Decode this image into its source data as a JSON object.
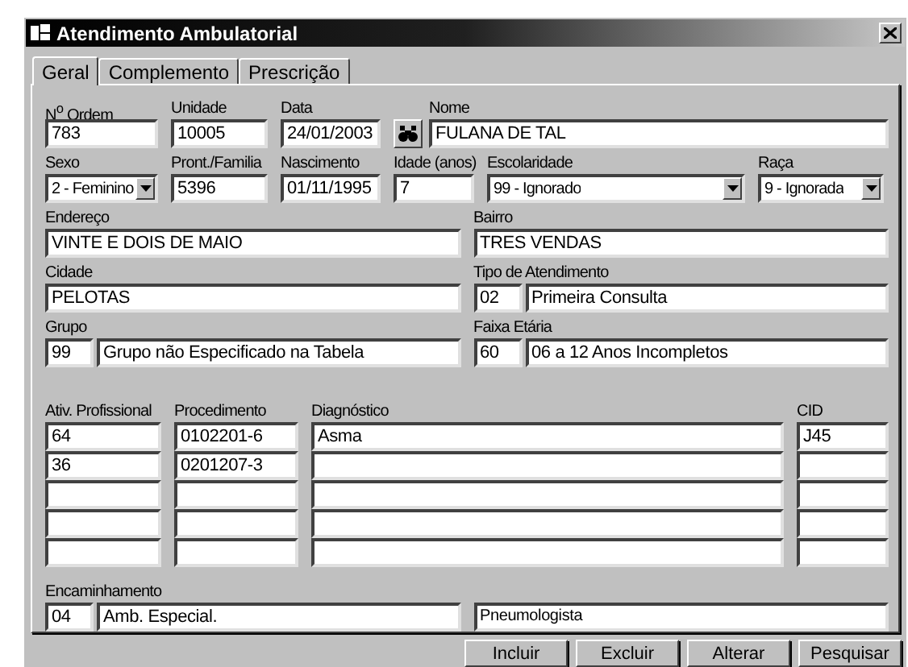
{
  "window": {
    "title": "Atendimento Ambulatorial"
  },
  "tabs": [
    {
      "label": "Geral",
      "selected": true
    },
    {
      "label": "Complemento",
      "selected": false
    },
    {
      "label": "Prescrição",
      "selected": false
    }
  ],
  "rows": [
    [
      {
        "kind": "text",
        "label": "N$^{o}$ Ordem",
        "value": "783"
      },
      {
        "kind": "text",
        "label": "Unidade",
        "value": "10005"
      },
      {
        "kind": "text",
        "label": "Data",
        "value": "24/01/2003"
      },
      {
        "kind": "search",
        "label": "Nome",
        "value": "FULANA DE TAL"
      }
    ],
    [
      {
        "kind": "select",
        "label": "Sexo",
        "value": "2 - Feminino"
      },
      {
        "kind": "text",
        "label": "Pront./Familia",
        "value": "5396"
      },
      {
        "kind": "text",
        "label": "Nascimento",
        "value": "01/11/1995"
      },
      {
        "kind": "text",
        "label": "Idade (anos)",
        "value": "7"
      },
      {
        "kind": "select",
        "label": "Escolaridade",
        "value": "99 - Ignorado"
      },
      {
        "kind": "select",
        "label": "Raça",
        "value": "9 - Ignorada"
      }
    ],
    [
      {
        "kind": "text",
        "label": "Endereço",
        "value": "VINTE E DOIS DE MAIO"
      },
      {
        "kind": "text",
        "label": "Bairro",
        "value": "TRES VENDAS"
      }
    ],
    [
      {
        "kind": "text",
        "label": "Cidade",
        "value": "PELOTAS"
      },
      {
        "kind": "coded",
        "label": "Tipo de Atendimento",
        "code": "02",
        "value": "Primeira Consulta"
      }
    ],
    [
      {
        "kind": "coded",
        "label": "Grupo",
        "code": "99",
        "value": "Grupo não Especificado na Tabela"
      },
      {
        "kind": "coded",
        "label": "Faixa Etária",
        "code": "60",
        "value": "06 a 12 Anos Incompletos"
      }
    ]
  ],
  "procedures": {
    "columns": [
      "Ativ. Profissional",
      "Procedimento",
      "Diagnóstico",
      "CID"
    ],
    "rows": [
      {
        "ativ": "64",
        "procedimento": "0102201-6",
        "diagnostico": "Asma",
        "cid": "J45"
      },
      {
        "ativ": "36",
        "procedimento": "0201207-3"
      }
    ]
  },
  "referral": {
    "label": "Encaminhamento",
    "code": "04",
    "value": "Amb. Especial.",
    "detail": "Pneumologista"
  },
  "buttons": [
    "Incluir",
    "Excluir",
    "Alterar",
    "Pesquisar"
  ]
}
